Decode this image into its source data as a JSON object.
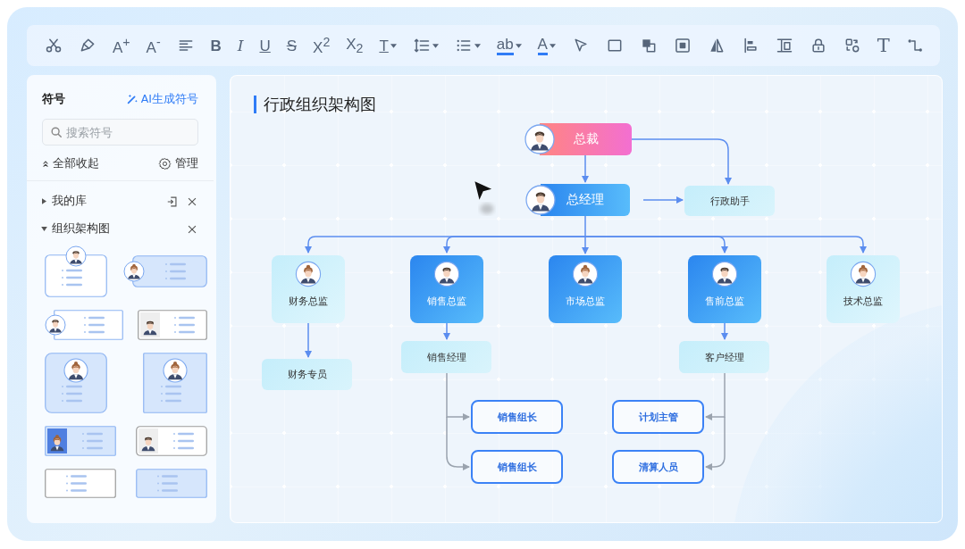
{
  "toolbar": [
    {
      "kind": "icon",
      "dropdown": false
    },
    {
      "kind": "icon",
      "dropdown": false
    },
    {
      "kind": "plain",
      "label": "A$^{+}$",
      "dropdown": false
    },
    {
      "kind": "plain",
      "label": "A$^{-}$",
      "dropdown": false
    },
    {
      "kind": "icon",
      "dropdown": false
    },
    {
      "kind": "bold",
      "label": "B",
      "dropdown": false
    },
    {
      "kind": "italic",
      "label": "I",
      "dropdown": false
    },
    {
      "kind": "underline",
      "label": "U",
      "dropdown": false
    },
    {
      "kind": "strike",
      "label": "S",
      "dropdown": false
    },
    {
      "kind": "plain",
      "label": "X$^{2}$",
      "dropdown": false
    },
    {
      "kind": "plain",
      "label": "X$_{2}$",
      "dropdown": false
    },
    {
      "kind": "underline",
      "label": "T",
      "dropdown": true
    },
    {
      "kind": "icon",
      "dropdown": true
    },
    {
      "kind": "icon",
      "dropdown": true
    },
    {
      "kind": "accent",
      "label": "ab",
      "dropdown": true
    },
    {
      "kind": "accent",
      "label": "A",
      "dropdown": true
    },
    {
      "kind": "icon",
      "dropdown": false
    },
    {
      "kind": "icon",
      "dropdown": false
    },
    {
      "kind": "icon",
      "dropdown": false
    },
    {
      "kind": "icon",
      "dropdown": false
    },
    {
      "kind": "icon",
      "dropdown": false
    },
    {
      "kind": "icon",
      "dropdown": false
    },
    {
      "kind": "icon",
      "dropdown": false
    },
    {
      "kind": "icon",
      "dropdown": false
    },
    {
      "kind": "icon",
      "dropdown": false
    },
    {
      "kind": "serif",
      "label": "T",
      "dropdown": false
    },
    {
      "kind": "icon",
      "dropdown": false
    }
  ],
  "sidebar": {
    "title": "符号",
    "ai_link": "AI生成符号",
    "search": {
      "placeholder": "搜索符号"
    },
    "collapse_all": "全部收起",
    "manage": "管理",
    "libraries": [
      {
        "label": "我的库",
        "expanded": false
      },
      {
        "label": "组织架构图",
        "expanded": true,
        "templates": [
          {
            "kind": "avatar-top"
          },
          {
            "kind": "avatar-left-filled"
          },
          {
            "kind": "avatar-left-outline"
          },
          {
            "kind": "photo-outline"
          },
          {
            "kind": "avatar-center-rounded"
          },
          {
            "kind": "avatar-center-square"
          },
          {
            "kind": "photo-filled"
          },
          {
            "kind": "photo-grey"
          },
          {
            "kind": "plain-outline"
          },
          {
            "kind": "plain-filled"
          }
        ]
      }
    ]
  },
  "canvas": {
    "title": "行政组织架构图",
    "nodes": [
      {
        "label": "总裁",
        "kind": "ceo"
      },
      {
        "label": "总经理",
        "kind": "gm"
      },
      {
        "label": "行政助手",
        "kind": "tag"
      },
      {
        "label": "财务总监",
        "kind": "director-light"
      },
      {
        "label": "销售总监",
        "kind": "director-blue"
      },
      {
        "label": "市场总监",
        "kind": "director-blue"
      },
      {
        "label": "售前总监",
        "kind": "director-blue"
      },
      {
        "label": "技术总监",
        "kind": "director-light"
      },
      {
        "label": "财务专员",
        "kind": "tag"
      },
      {
        "label": "销售经理",
        "kind": "tag"
      },
      {
        "label": "客户经理",
        "kind": "tag"
      },
      {
        "label": "销售组长",
        "kind": "lead"
      },
      {
        "label": "销售组长",
        "kind": "lead"
      },
      {
        "label": "计划主管",
        "kind": "lead"
      },
      {
        "label": "清算人员",
        "kind": "lead"
      }
    ]
  }
}
